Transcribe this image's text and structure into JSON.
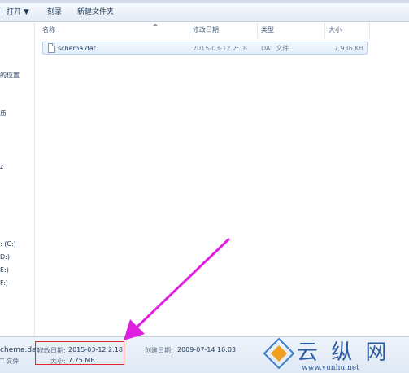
{
  "toolbar": {
    "open_label": "打开 ▼",
    "burn_label": "刻录",
    "new_folder_label": "新建文件夹"
  },
  "nav": {
    "items": [
      "的位置",
      "质",
      "z",
      ": (C:)",
      "D:)",
      "E:)",
      "F:)"
    ]
  },
  "columns": {
    "name": "名称",
    "modified": "修改日期",
    "type": "类型",
    "size": "大小"
  },
  "file": {
    "name": "schema.dat",
    "modified": "2015-03-12 2:18",
    "type": "DAT 文件",
    "size": "7,936 KB"
  },
  "details": {
    "filename": "chema.dat",
    "filetype": "T 文件",
    "modified_label": "修改日期:",
    "modified_value": "2015-03-12 2:18",
    "size_label": "大小:",
    "size_value": "7.75 MB",
    "created_label": "创建日期:",
    "created_value": "2009-07-14 10:03"
  },
  "watermark": {
    "brand": "云 纵 网",
    "url": "www.yunhu.net"
  },
  "colors": {
    "highlight_box": "#e22a2a",
    "arrow": "#e020e0"
  }
}
